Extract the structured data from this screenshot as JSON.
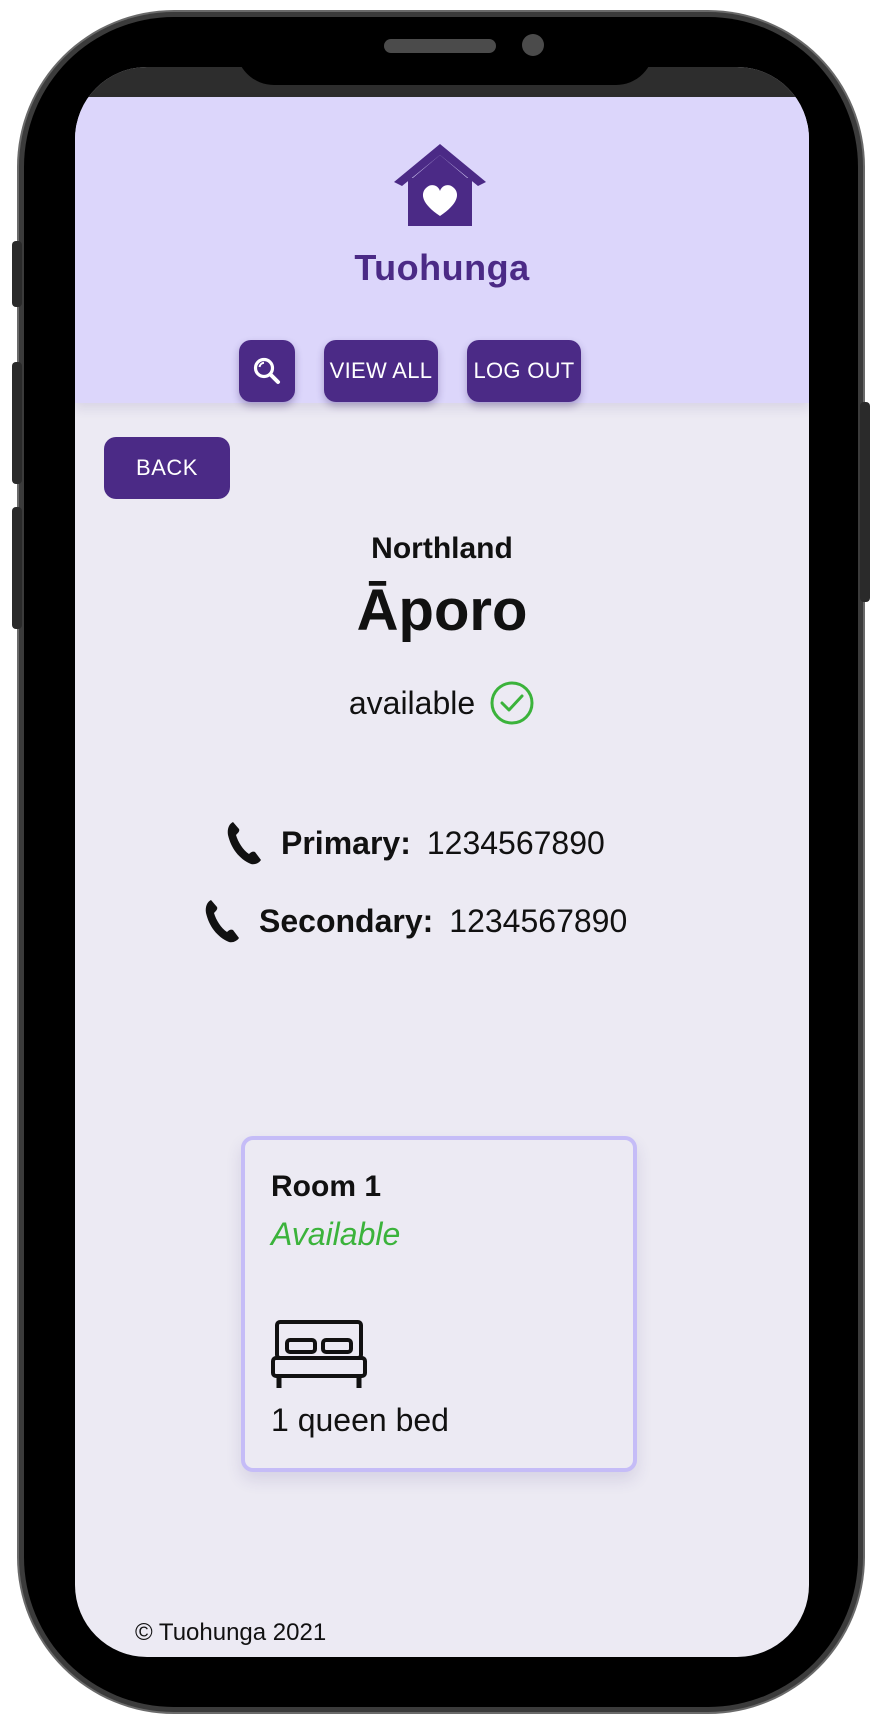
{
  "header": {
    "brand": "Tuohunga",
    "nav": {
      "search_icon": "search-icon",
      "view_all_label": "VIEW ALL",
      "log_out_label": "LOG OUT"
    }
  },
  "main": {
    "back_label": "BACK",
    "region": "Northland",
    "place_name": "Āporo",
    "availability": {
      "text": "available",
      "icon": "check-circle-icon",
      "color": "#3bb33b"
    },
    "contacts": [
      {
        "label": "Primary:",
        "value": "1234567890",
        "icon": "phone-icon"
      },
      {
        "label": "Secondary:",
        "value": "1234567890",
        "icon": "phone-icon"
      }
    ],
    "rooms": [
      {
        "title": "Room 1",
        "status": "Available",
        "bed_icon": "bed-icon",
        "beds": "1 queen bed"
      }
    ]
  },
  "footer": {
    "copyright": "© Tuohunga 2021"
  },
  "colors": {
    "brand_purple": "#4b2a86",
    "header_bg": "#dcd6fb",
    "page_bg": "#eceaf3",
    "card_border": "#c5bcf7",
    "available_green": "#3bb33b"
  }
}
